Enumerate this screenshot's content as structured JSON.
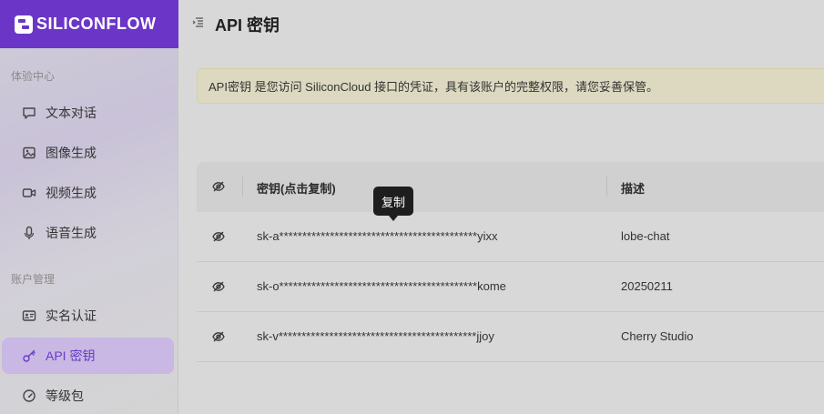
{
  "brand": {
    "logo_text": "SILICONFLOW",
    "accent": "#6b36c7"
  },
  "header": {
    "title": "API 密钥",
    "menu_icon": "menu-collapse-icon"
  },
  "sidebar": {
    "sections": [
      {
        "label": "体验中心",
        "items": [
          {
            "label": "文本对话",
            "icon": "chat-bubble-icon"
          },
          {
            "label": "图像生成",
            "icon": "image-icon"
          },
          {
            "label": "视频生成",
            "icon": "video-camera-icon"
          },
          {
            "label": "语音生成",
            "icon": "microphone-icon"
          }
        ]
      },
      {
        "label": "账户管理",
        "items": [
          {
            "label": "实名认证",
            "icon": "id-card-icon"
          },
          {
            "label": "API 密钥",
            "icon": "key-icon",
            "active": true
          },
          {
            "label": "等级包",
            "icon": "gauge-icon"
          }
        ]
      }
    ]
  },
  "notice": {
    "text": "API密钥 是您访问 SiliconCloud 接口的凭证，具有该账户的完整权限，请您妥善保管。"
  },
  "table": {
    "columns": [
      "密钥(点击复制)",
      "描述"
    ],
    "rows": [
      {
        "key": "sk-a*******************************************yixx",
        "description": "lobe-chat"
      },
      {
        "key": "sk-o*******************************************kome",
        "description": "20250211"
      },
      {
        "key": "sk-v*******************************************jjoy",
        "description": "Cherry Studio"
      }
    ]
  },
  "tooltip": {
    "text": "复制"
  }
}
